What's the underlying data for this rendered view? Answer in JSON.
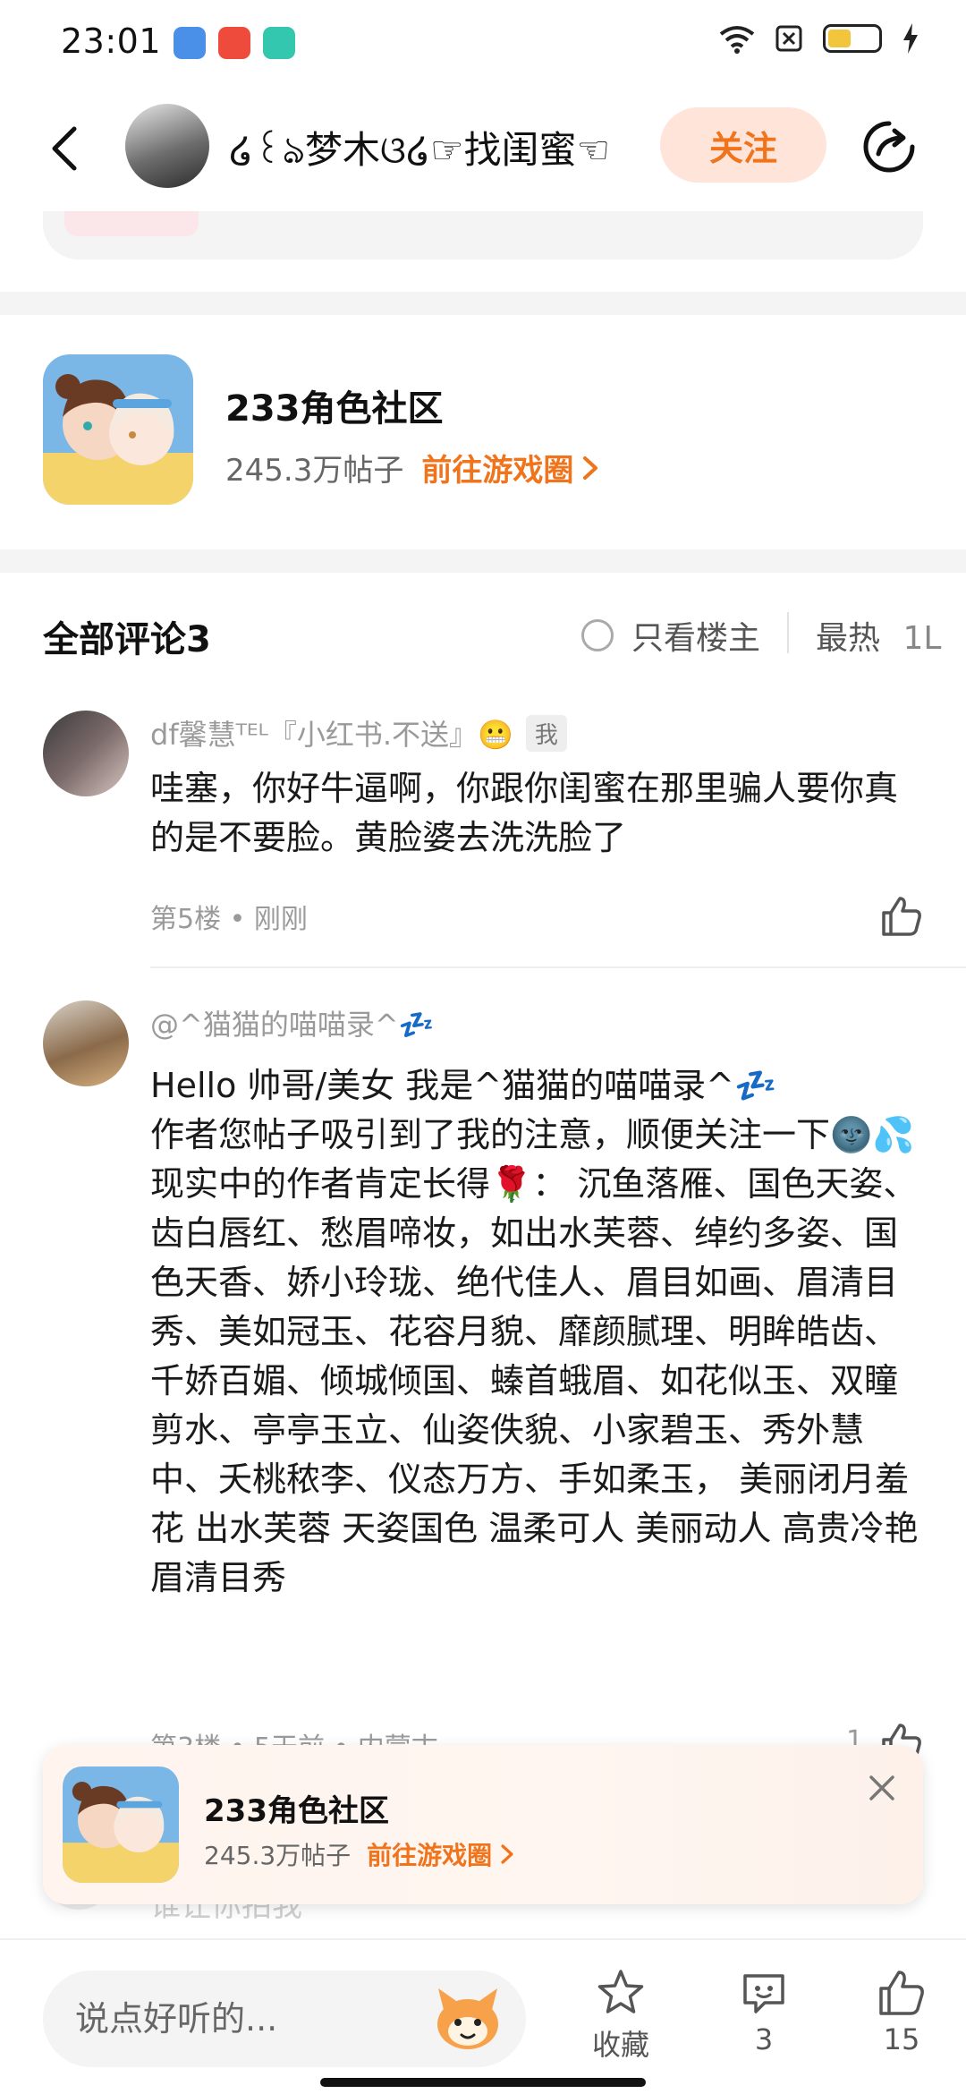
{
  "status_bar": {
    "time": "23:01"
  },
  "header": {
    "author_name": "໒꒰ঌ梦木ଓ໒☞找闺蜜☜",
    "follow_label": "关注"
  },
  "circle": {
    "name": "233角色社区",
    "post_count": "245.3万帖子",
    "link_label": "前往游戏圈"
  },
  "comments_section": {
    "title": "全部评论3",
    "only_author_label": "只看楼主",
    "sort_label": "最热",
    "sort_overflow": "1L"
  },
  "comments": [
    {
      "author": "df馨慧ᵀᴱᴸ『小红书.不送』😬",
      "author_tag": "我",
      "text": "哇塞，你好牛逼啊，你跟你闺蜜在那里骗人要你真的是不要脸。黄脸婆去洗洗脸了",
      "meta": "第5楼 • 刚刚"
    },
    {
      "author": "@^猫猫的喵喵录^💤",
      "text_lines": [
        "Hello  帅哥/美女  我是^猫猫的喵喵录^💤",
        "作者您帖子吸引到了我的注意，顺便关注一下🌚💦",
        "现实中的作者肯定长得🌹：  沉鱼落雁、国色天姿、齿白唇红、愁眉啼妆，如出水芙蓉、绰约多姿、国色天香、娇小玲珑、绝代佳人、眉目如画、眉清目秀、美如冠玉、花容月貌、靡颜腻理、明眸皓齿、千娇百媚、倾城倾国、螓首蛾眉、如花似玉、双瞳剪水、亭亭玉立、仙姿佚貌、小家碧玉、秀外慧中、夭桃秾李、仪态万方、手如柔玉，  美丽闭月羞花   出水芙蓉   天姿国色   温柔可人   美丽动人   高贵冷艳  眉清目秀"
      ],
      "meta": "第3楼 • 5天前 • 内蒙古",
      "like_count": "1"
    }
  ],
  "faded_comment": "谁让你拍我",
  "float_banner": {
    "name": "233角色社区",
    "post_count": "245.3万帖子",
    "link_label": "前往游戏圈"
  },
  "bottom_bar": {
    "input_placeholder": "说点好听的...",
    "collect_label": "收藏",
    "comment_count": "3",
    "like_count": "15"
  },
  "colors": {
    "accent": "#f0741c",
    "follow_bg": "#ffe5d9",
    "divider_bg": "#f4f4f4"
  }
}
